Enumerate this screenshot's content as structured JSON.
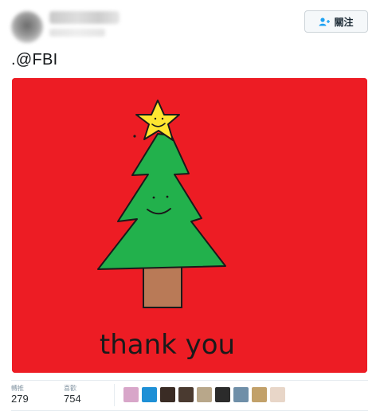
{
  "header": {
    "follow_label": "關注"
  },
  "tweet": {
    "text": ".@FBI"
  },
  "media": {
    "background_color": "#ed1c24",
    "caption": "thank you"
  },
  "stats": {
    "retweets_label": "轉推",
    "retweets_value": "279",
    "likes_label": "喜歡",
    "likes_value": "754"
  },
  "likers": [
    {
      "color": "#d8a6c9"
    },
    {
      "color": "#1e90d6"
    },
    {
      "color": "#3a2c25"
    },
    {
      "color": "#4a3a30"
    },
    {
      "color": "#b8a78a"
    },
    {
      "color": "#2b2b2b"
    },
    {
      "color": "#6f8fa8"
    },
    {
      "color": "#c2a16a"
    },
    {
      "color": "#e8d6c8"
    }
  ]
}
